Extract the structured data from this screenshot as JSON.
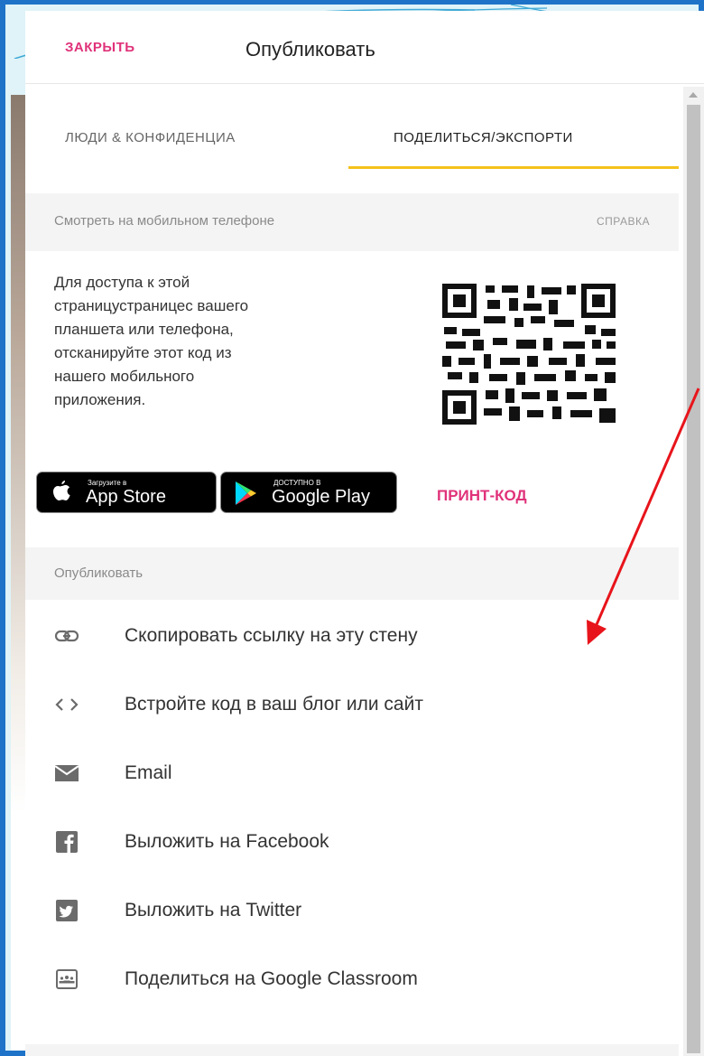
{
  "header": {
    "close_label": "ЗАКРЫТЬ",
    "title": "Опубликовать"
  },
  "tabs": [
    {
      "label": "ЛЮДИ & КОНФИДЕНЦИА",
      "active": false
    },
    {
      "label": "ПОДЕЛИТЬСЯ/ЭКСПОРТИ",
      "active": true
    }
  ],
  "mobile_section": {
    "heading": "Смотреть на мобильном телефоне",
    "help_label": "СПРАВКА",
    "lines": [
      "Для доступа к этой",
      "страницустраницес вашего",
      "планшета или телефона,",
      "отсканируйте этот код из",
      "нашего мобильного",
      "приложения."
    ],
    "app_store": {
      "small": "Загрузите в",
      "big": "App Store"
    },
    "google_play": {
      "small": "ДОСТУПНО В",
      "big": "Google Play"
    },
    "print_label": "ПРИНТ-КОД"
  },
  "publish_section": {
    "heading": "Опубликовать",
    "items": [
      {
        "icon": "link-icon",
        "label": "Скопировать ссылку на эту стену"
      },
      {
        "icon": "code-icon",
        "label": "Встройте код в ваш блог или сайт"
      },
      {
        "icon": "mail-icon",
        "label": "Email"
      },
      {
        "icon": "facebook-icon",
        "label": "Выложить на Facebook"
      },
      {
        "icon": "twitter-icon",
        "label": "Выложить на Twitter"
      },
      {
        "icon": "classroom-icon",
        "label": "Поделиться на Google Classroom"
      }
    ]
  },
  "colors": {
    "accent": "#e0327a",
    "tab_underline": "#f4c21b",
    "frame_border": "#1e73c8",
    "arrow": "#e8141b"
  }
}
